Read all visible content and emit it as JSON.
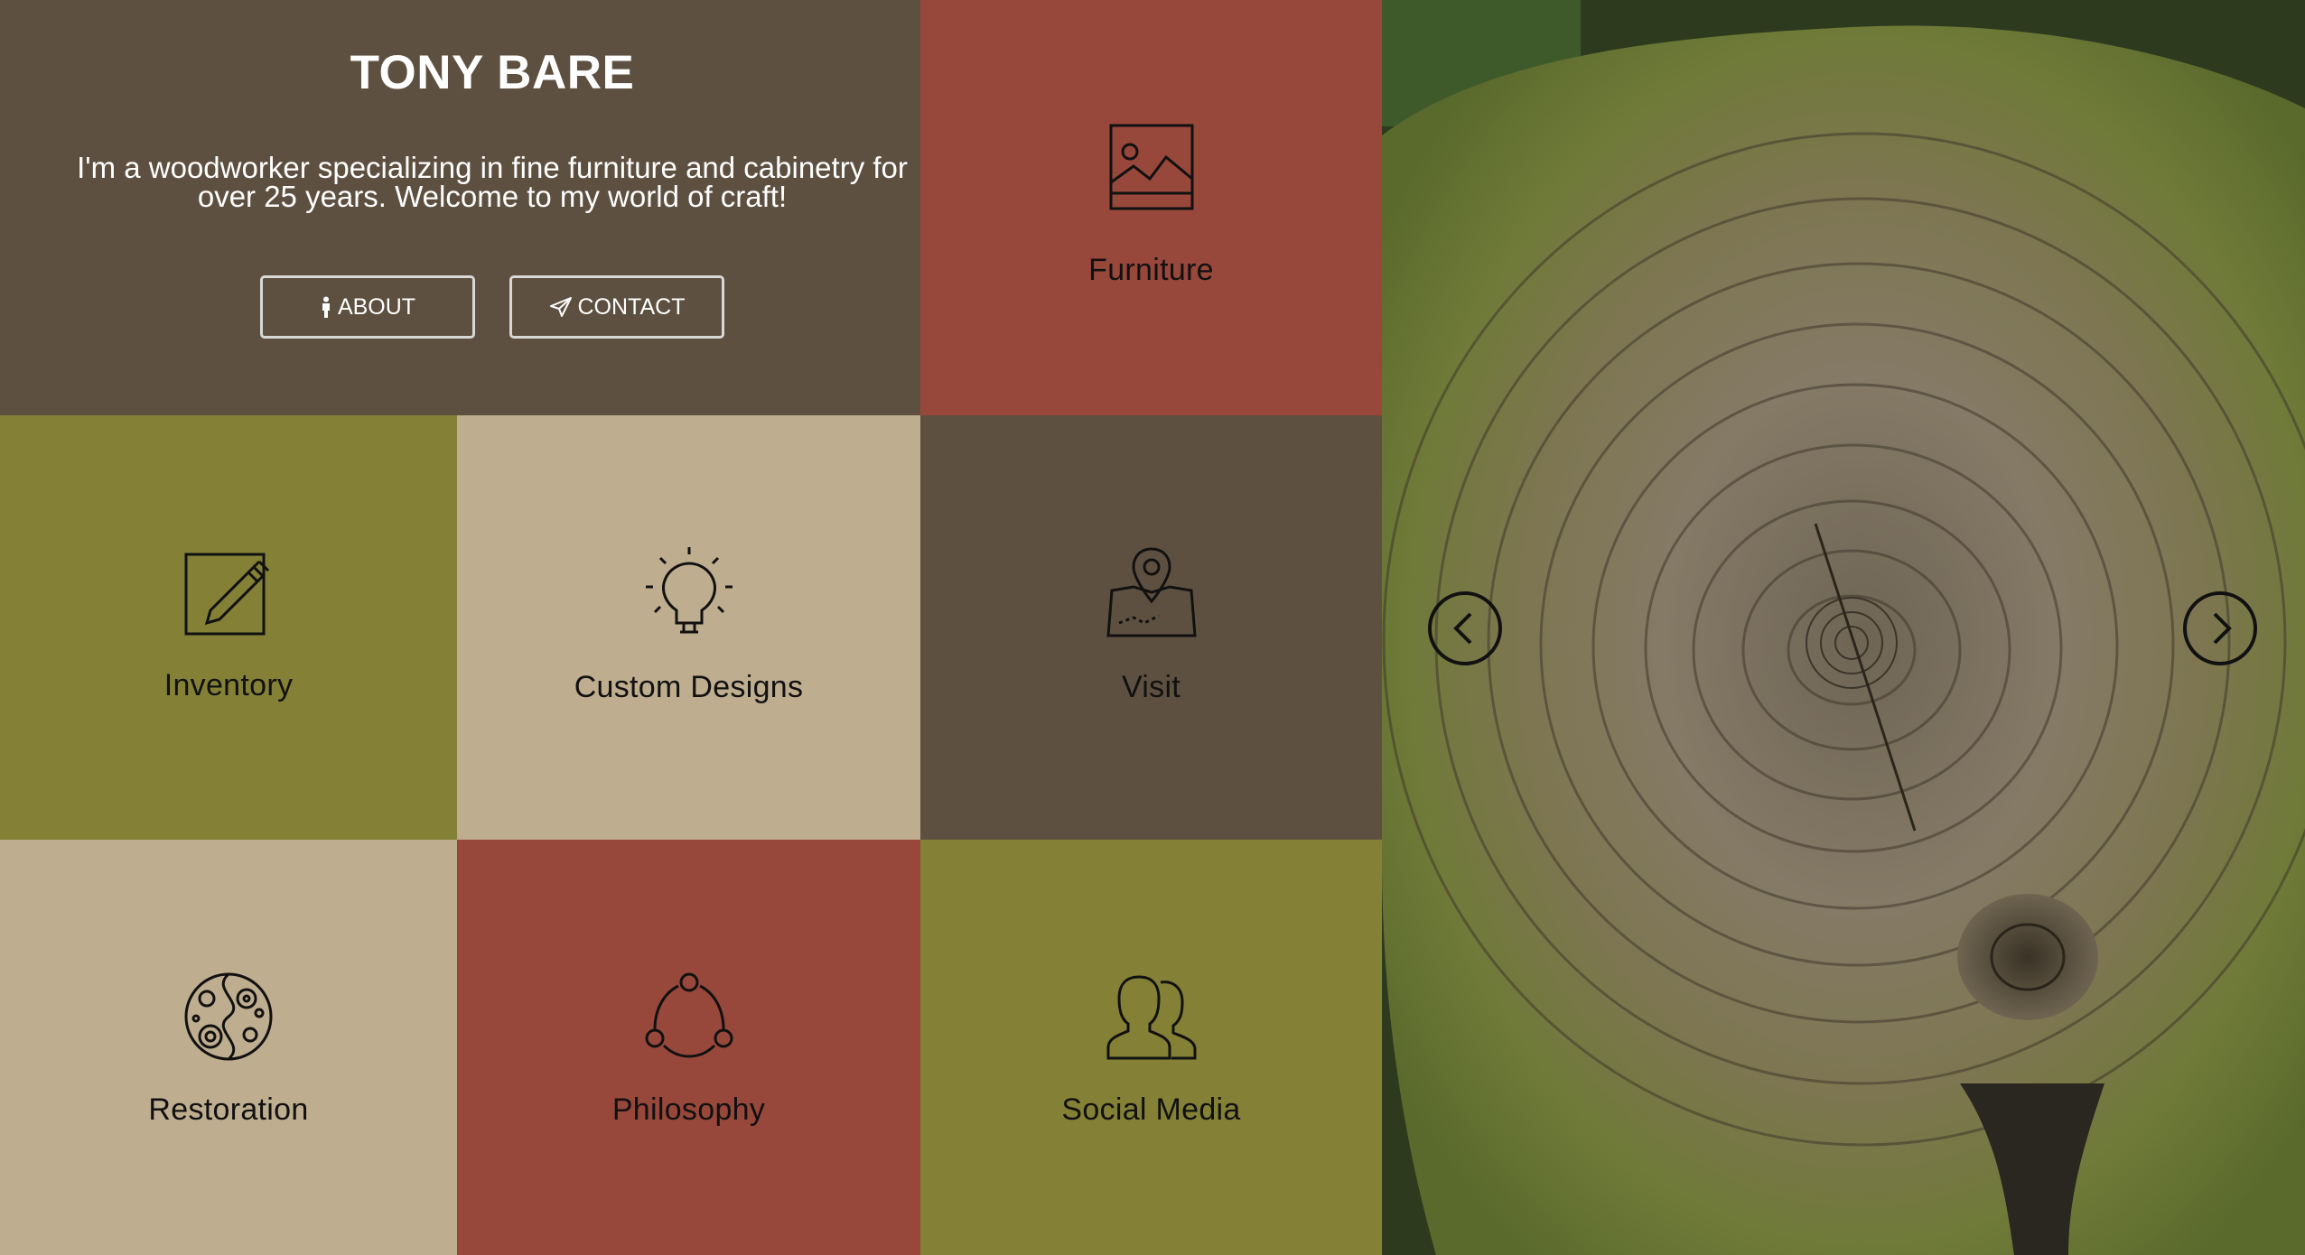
{
  "hero": {
    "title": "TONY BARE",
    "description": "I'm a woodworker specializing in fine furniture and cabinetry for over 25 years. Welcome to my world of craft!",
    "about_label": "ABOUT",
    "contact_label": "CONTACT"
  },
  "tiles": {
    "furniture": {
      "label": "Furniture",
      "icon": "image-icon"
    },
    "inventory": {
      "label": "Inventory",
      "icon": "edit-icon"
    },
    "custom_designs": {
      "label": "Custom Designs",
      "icon": "lightbulb-icon"
    },
    "visit": {
      "label": "Visit",
      "icon": "map-pin-icon"
    },
    "restoration": {
      "label": "Restoration",
      "icon": "gears-icon"
    },
    "philosophy": {
      "label": "Philosophy",
      "icon": "cycle-icon"
    },
    "social_media": {
      "label": "Social Media",
      "icon": "users-icon"
    }
  },
  "colors": {
    "brown": "#5e5040",
    "red": "#98473b",
    "olive": "#848136",
    "tan": "#bfad8f"
  },
  "slider": {
    "prev_icon": "chevron-left-icon",
    "next_icon": "chevron-right-icon"
  }
}
